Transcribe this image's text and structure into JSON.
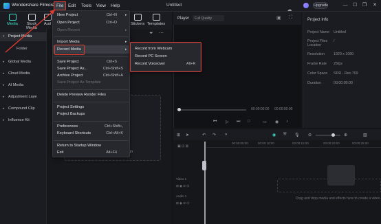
{
  "app": {
    "name": "Wondershare Filmora",
    "window_title": "Untitled",
    "upgrade_label": "Upgrade"
  },
  "menubar": {
    "items": [
      "File",
      "Edit",
      "Tools",
      "View",
      "Help"
    ]
  },
  "toolbar": {
    "items": [
      {
        "label": "Media",
        "icon": "media-icon"
      },
      {
        "label": "Stock Media",
        "icon": "stock-media-icon"
      },
      {
        "label": "Aud",
        "icon": "audio-icon"
      },
      {
        "label": "Stickers",
        "icon": "stickers-icon"
      },
      {
        "label": "Templates",
        "icon": "templates-icon"
      }
    ]
  },
  "sidebar": {
    "items": [
      {
        "label": "Project Media",
        "active": true
      },
      {
        "label": "Folder",
        "sub": true
      },
      {
        "label": "Global Media"
      },
      {
        "label": "Cloud Media"
      },
      {
        "label": "AI Media"
      },
      {
        "label": "Adjustment Laye"
      },
      {
        "label": "Compound Clip"
      },
      {
        "label": "Influence Kit"
      }
    ]
  },
  "media": {
    "import_hint": "ign"
  },
  "player": {
    "label": "Player",
    "quality": "Full Quality",
    "time_current": "00:00:00:00",
    "time_total": "00:00:00:00"
  },
  "project_info": {
    "title": "Project Info",
    "rows": [
      {
        "key": "Project Name",
        "value": "Untitled"
      },
      {
        "key": "Project Files Location",
        "value": "/"
      },
      {
        "key": "Resolution",
        "value": "1920 x 1080"
      },
      {
        "key": "Frame Rate",
        "value": "25fps"
      },
      {
        "key": "Color Space",
        "value": "SDR - Rec.709"
      },
      {
        "key": "Duration",
        "value": "00:00:00:00"
      }
    ]
  },
  "timeline": {
    "ticks": [
      "00:00",
      "00:00:05:00",
      "00:00:10:00",
      "00:00:15:00",
      "00:00:20:00",
      "00:00:25:00"
    ],
    "tracks": [
      "Video 1",
      "Audio 1"
    ],
    "drop_hint": "Drag and drop media and effects here to create a video."
  },
  "file_menu": {
    "items": [
      {
        "label": "New Project",
        "shortcut": "Ctrl+N",
        "submenu": true
      },
      {
        "label": "Open Project",
        "shortcut": "Ctrl+O"
      },
      {
        "label": "Open Recent",
        "disabled": true,
        "submenu": true
      },
      {
        "separator": true
      },
      {
        "label": "Import Media",
        "submenu": true
      },
      {
        "label": "Record Media",
        "submenu": true,
        "highlighted": true
      },
      {
        "separator": true
      },
      {
        "label": "Save Project",
        "shortcut": "Ctrl+S"
      },
      {
        "label": "Save Project As...",
        "shortcut": "Ctrl+Shift+S"
      },
      {
        "label": "Archive Project",
        "shortcut": "Ctrl+Shift+A"
      },
      {
        "label": "Save Project As Template",
        "disabled": true
      },
      {
        "separator": true
      },
      {
        "label": "Delete Preview Render Files"
      },
      {
        "separator": true
      },
      {
        "label": "Project Settings"
      },
      {
        "label": "Project Backups"
      },
      {
        "separator": true
      },
      {
        "label": "Preferences",
        "shortcut": "Ctrl+Shift+,"
      },
      {
        "label": "Keyboard Shortcuts",
        "shortcut": "Ctrl+Alt+K"
      },
      {
        "separator": true
      },
      {
        "label": "Return to Startup Window"
      },
      {
        "label": "Exit",
        "shortcut": "Alt+F4"
      }
    ]
  },
  "record_submenu": {
    "items": [
      {
        "label": "Record from Webcam",
        "shortcut": ""
      },
      {
        "label": "Record PC Screen",
        "shortcut": ""
      },
      {
        "label": "Record Voiceover",
        "shortcut": "Alt+R"
      }
    ]
  },
  "colors": {
    "accent": "#3fe0c9",
    "highlight": "#e03b2f",
    "background": "#141519"
  }
}
